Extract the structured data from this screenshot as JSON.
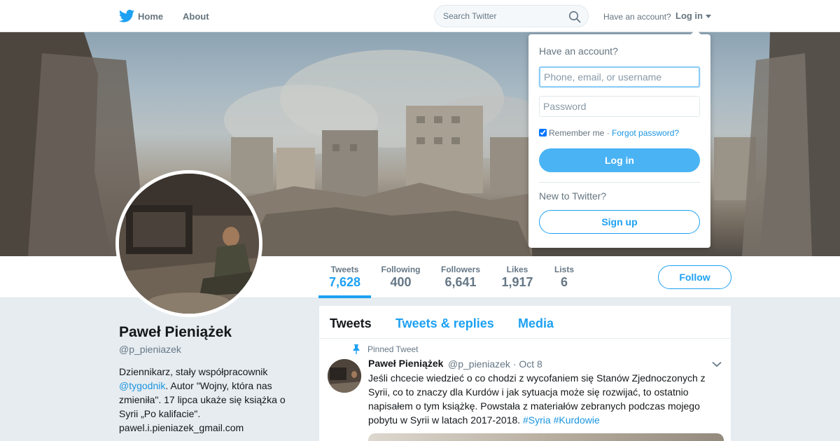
{
  "nav": {
    "home_label": "Home",
    "about_label": "About",
    "search_placeholder": "Search Twitter",
    "have_account": "Have an account?",
    "login_label": "Log in",
    "twitter_icon": "twitter-bird-icon",
    "search_icon": "magnifier-icon",
    "accent": "#1da1f2"
  },
  "profile": {
    "name": "Paweł Pieniążek",
    "handle": "@p_pieniazek",
    "bio_part1": "Dziennikarz, stały współpracownik ",
    "bio_link": "@tygodnik",
    "bio_part2": ". Autor \"Wojny, która nas zmieniła\". 17 lipca ukaże się książka o Syrii „Po kalifacie\". pawel.i.pieniazek_gmail.com"
  },
  "stats": [
    {
      "label": "Tweets",
      "value": "7,628"
    },
    {
      "label": "Following",
      "value": "400"
    },
    {
      "label": "Followers",
      "value": "6,641"
    },
    {
      "label": "Likes",
      "value": "1,917"
    },
    {
      "label": "Lists",
      "value": "6"
    }
  ],
  "follow_label": "Follow",
  "timeline": {
    "tabs": [
      "Tweets",
      "Tweets & replies",
      "Media"
    ],
    "pinned_label": "Pinned Tweet",
    "tweet": {
      "name": "Paweł Pieniążek",
      "meta": "@p_pieniazek · Oct 8",
      "text": "Jeśli chcecie wiedzieć o co chodzi z wycofaniem się Stanów Zjednoczonych z Syrii, co to znaczy dla Kurdów i jak sytuacja może się rozwijać, to ostatnio napisałem o tym książkę. Powstała z materiałów zebranych podczas mojego pobytu w Syrii w latach 2017-2018. ",
      "hashtags": "#Syria #Kurdowie"
    }
  },
  "login_dropdown": {
    "title": "Have an account?",
    "username_placeholder": "Phone, email, or username",
    "password_placeholder": "Password",
    "remember_label": "Remember me",
    "separator": " · ",
    "forgot_label": "Forgot password?",
    "login_button": "Log in",
    "new_label": "New to Twitter?",
    "signup_button": "Sign up"
  }
}
